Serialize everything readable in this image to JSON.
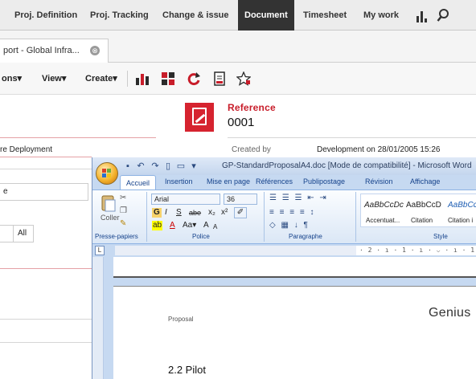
{
  "topnav": {
    "items": [
      "Proj. Definition",
      "Proj. Tracking",
      "Change & issue",
      "Document",
      "Timesheet",
      "My work"
    ],
    "active": "Document"
  },
  "tab": {
    "label": "port - Global Infra...",
    "close": "⊗"
  },
  "actionbar": {
    "menus": [
      "ons▾",
      "View▾",
      "Create▾"
    ]
  },
  "record": {
    "reference_label": "Reference",
    "reference_value": "0001",
    "left_field_1": "re Deployment",
    "created_by_label": "Created by",
    "created_by_value": "Development on 28/01/2005 15:26",
    "left_field_2": "e",
    "all_button": "All"
  },
  "word": {
    "title": "GP-StandardProposalA4.doc [Mode de compatibilité] - Microsoft Word",
    "tabs": [
      "Accueil",
      "Insertion",
      "Mise en page",
      "Références",
      "Publipostage",
      "Révision",
      "Affichage"
    ],
    "active_tab": "Accueil",
    "clipboard": {
      "paste": "Coller",
      "label": "Presse-papiers"
    },
    "font": {
      "name": "Arial",
      "size": "36",
      "label": "Police",
      "aa": "Aa▾",
      "grow": "A",
      "shrink": "A",
      "bold": "G",
      "italic": "I",
      "underline": "S",
      "strike": "abe",
      "sub": "x₂",
      "sup": "x²"
    },
    "paragraph": {
      "label": "Paragraphe"
    },
    "styles": {
      "label": "Style",
      "items": [
        {
          "sample": "AaBbCcDc",
          "name": "Accentuat..."
        },
        {
          "sample": "AaBbCcD",
          "name": "Citation"
        },
        {
          "sample": "AaBbCc",
          "name": "Citation i"
        }
      ]
    },
    "ruler": "· 2 · ı · 1 · ı · ⌵ · ı · 1 · ı · 2 · ı · 3",
    "page": {
      "header_left": "Proposal",
      "header_right": "Genius",
      "heading": "2.2 Pilot"
    }
  },
  "colors": {
    "accent_red": "#d6232f",
    "nav_active_bg": "#333333",
    "word_blue": "#c6d9f1"
  }
}
